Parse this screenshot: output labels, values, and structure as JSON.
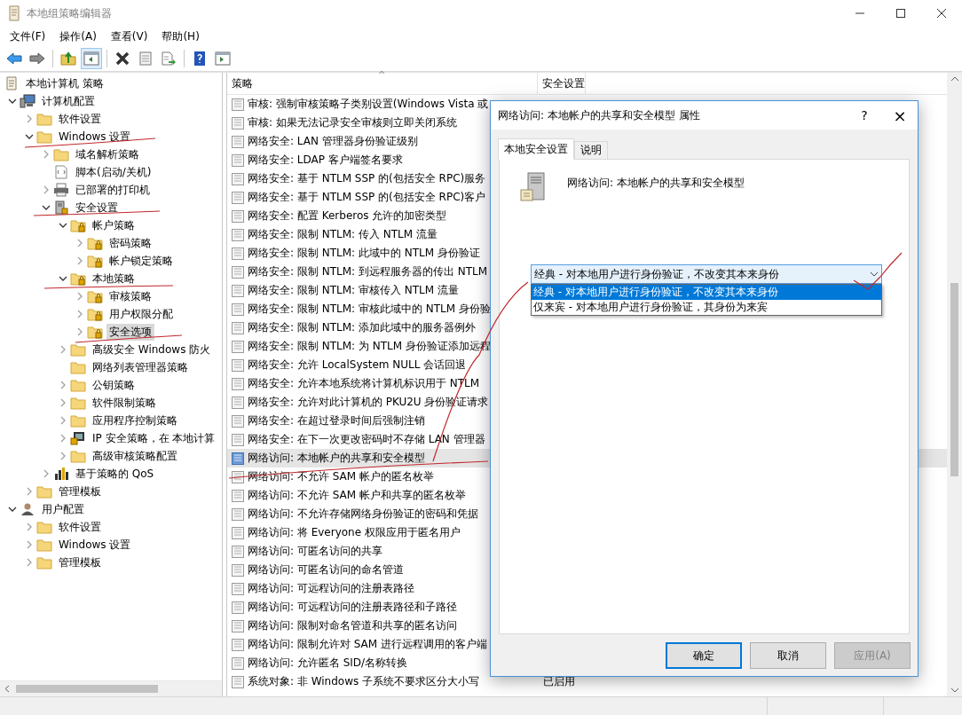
{
  "window": {
    "title": "本地组策略编辑器"
  },
  "menu": [
    "文件(F)",
    "操作(A)",
    "查看(V)",
    "帮助(H)"
  ],
  "toolbar": [
    {
      "kind": "back",
      "pressed": false
    },
    {
      "kind": "forward",
      "pressed": false
    },
    {
      "kind": "sep"
    },
    {
      "kind": "up",
      "pressed": false
    },
    {
      "kind": "tree",
      "pressed": true
    },
    {
      "kind": "sep"
    },
    {
      "kind": "delete",
      "pressed": false
    },
    {
      "kind": "properties",
      "pressed": false
    },
    {
      "kind": "export",
      "pressed": false
    },
    {
      "kind": "sep"
    },
    {
      "kind": "help",
      "pressed": false
    },
    {
      "kind": "pane",
      "pressed": false
    }
  ],
  "tree": [
    {
      "label": "本地计算机 策略",
      "kind": "root",
      "selected": false,
      "children": [
        {
          "label": "计算机配置",
          "kind": "computer",
          "expanded": true,
          "selected": false,
          "children": [
            {
              "label": "软件设置",
              "kind": "folder",
              "expanded": false,
              "selected": false
            },
            {
              "label": "Windows 设置",
              "kind": "folder",
              "expanded": true,
              "selected": false,
              "children": [
                {
                  "label": "域名解析策略",
                  "kind": "folder",
                  "expanded": false,
                  "selected": false
                },
                {
                  "label": "脚本(启动/关机)",
                  "kind": "script",
                  "selected": false
                },
                {
                  "label": "已部署的打印机",
                  "kind": "printer",
                  "expanded": false,
                  "selected": false
                },
                {
                  "label": "安全设置",
                  "kind": "server",
                  "expanded": true,
                  "selected": false,
                  "children": [
                    {
                      "label": "帐户策略",
                      "kind": "secure-folder",
                      "expanded": true,
                      "selected": false,
                      "children": [
                        {
                          "label": "密码策略",
                          "kind": "secure-folder",
                          "expanded": false,
                          "selected": false
                        },
                        {
                          "label": "帐户锁定策略",
                          "kind": "secure-folder",
                          "expanded": false,
                          "selected": false
                        }
                      ]
                    },
                    {
                      "label": "本地策略",
                      "kind": "secure-folder",
                      "expanded": true,
                      "selected": false,
                      "children": [
                        {
                          "label": "审核策略",
                          "kind": "secure-folder",
                          "expanded": false,
                          "selected": false
                        },
                        {
                          "label": "用户权限分配",
                          "kind": "secure-folder",
                          "expanded": false,
                          "selected": false
                        },
                        {
                          "label": "安全选项",
                          "kind": "secure-folder",
                          "expanded": false,
                          "selected": true
                        }
                      ]
                    },
                    {
                      "label": "高级安全 Windows 防火",
                      "kind": "folder",
                      "expanded": false,
                      "selected": false
                    },
                    {
                      "label": "网络列表管理器策略",
                      "kind": "folder",
                      "selected": false
                    },
                    {
                      "label": "公钥策略",
                      "kind": "folder",
                      "expanded": false,
                      "selected": false
                    },
                    {
                      "label": "软件限制策略",
                      "kind": "folder",
                      "expanded": false,
                      "selected": false
                    },
                    {
                      "label": "应用程序控制策略",
                      "kind": "folder",
                      "expanded": false,
                      "selected": false
                    },
                    {
                      "label": "IP 安全策略，在 本地计算",
                      "kind": "monitor",
                      "expanded": false,
                      "selected": false
                    },
                    {
                      "label": "高级审核策略配置",
                      "kind": "folder",
                      "expanded": false,
                      "selected": false
                    }
                  ]
                },
                {
                  "label": "基于策略的 QoS",
                  "kind": "chart",
                  "expanded": false,
                  "selected": false
                }
              ]
            },
            {
              "label": "管理模板",
              "kind": "folder",
              "expanded": false,
              "selected": false
            }
          ]
        },
        {
          "label": "用户配置",
          "kind": "user",
          "expanded": true,
          "selected": false,
          "children": [
            {
              "label": "软件设置",
              "kind": "folder",
              "expanded": false,
              "selected": false
            },
            {
              "label": "Windows 设置",
              "kind": "folder",
              "expanded": false,
              "selected": false
            },
            {
              "label": "管理模板",
              "kind": "folder",
              "expanded": false,
              "selected": false
            }
          ]
        }
      ]
    }
  ],
  "table": {
    "sort_indicator": "^",
    "columns": [
      "策略",
      "安全设置"
    ],
    "rows": [
      {
        "policy": "审核: 强制审核策略子类别设置(Windows Vista 或",
        "selected": false
      },
      {
        "policy": "审核: 如果无法记录安全审核则立即关闭系统",
        "selected": false
      },
      {
        "policy": "网络安全: LAN 管理器身份验证级别",
        "selected": false
      },
      {
        "policy": "网络安全: LDAP 客户端签名要求",
        "selected": false
      },
      {
        "policy": "网络安全: 基于 NTLM SSP 的(包括安全 RPC)服务",
        "selected": false
      },
      {
        "policy": "网络安全: 基于 NTLM SSP 的(包括安全 RPC)客户",
        "selected": false
      },
      {
        "policy": "网络安全: 配置 Kerberos 允许的加密类型",
        "selected": false
      },
      {
        "policy": "网络安全: 限制 NTLM: 传入 NTLM 流量",
        "selected": false
      },
      {
        "policy": "网络安全: 限制 NTLM: 此域中的 NTLM 身份验证",
        "selected": false
      },
      {
        "policy": "网络安全: 限制 NTLM: 到远程服务器的传出 NTLM",
        "selected": false
      },
      {
        "policy": "网络安全: 限制 NTLM: 审核传入 NTLM 流量",
        "selected": false
      },
      {
        "policy": "网络安全: 限制 NTLM: 审核此域中的 NTLM 身份验",
        "selected": false
      },
      {
        "policy": "网络安全: 限制 NTLM: 添加此域中的服务器例外",
        "selected": false
      },
      {
        "policy": "网络安全: 限制 NTLM: 为 NTLM 身份验证添加远程",
        "selected": false
      },
      {
        "policy": "网络安全: 允许 LocalSystem NULL 会话回退",
        "selected": false
      },
      {
        "policy": "网络安全: 允许本地系统将计算机标识用于 NTLM",
        "selected": false
      },
      {
        "policy": "网络安全: 允许对此计算机的 PKU2U 身份验证请求",
        "selected": false
      },
      {
        "policy": "网络安全: 在超过登录时间后强制注销",
        "selected": false
      },
      {
        "policy": "网络安全: 在下一次更改密码时不存储 LAN 管理器",
        "selected": false
      },
      {
        "policy": "网络访问: 本地帐户的共享和安全模型",
        "selected": true
      },
      {
        "policy": "网络访问: 不允许 SAM 帐户的匿名枚举",
        "selected": false
      },
      {
        "policy": "网络访问: 不允许 SAM 帐户和共享的匿名枚举",
        "selected": false
      },
      {
        "policy": "网络访问: 不允许存储网络身份验证的密码和凭据",
        "selected": false
      },
      {
        "policy": "网络访问: 将 Everyone 权限应用于匿名用户",
        "selected": false
      },
      {
        "policy": "网络访问: 可匿名访问的共享",
        "selected": false
      },
      {
        "policy": "网络访问: 可匿名访问的命名管道",
        "selected": false
      },
      {
        "policy": "网络访问: 可远程访问的注册表路径",
        "selected": false
      },
      {
        "policy": "网络访问: 可远程访问的注册表路径和子路径",
        "selected": false
      },
      {
        "policy": "网络访问: 限制对命名管道和共享的匿名访问",
        "selected": false
      },
      {
        "policy": "网络访问: 限制允许对 SAM 进行远程调用的客户端",
        "selected": false
      },
      {
        "policy": "网络访问: 允许匿名 SID/名称转换",
        "selected": false
      },
      {
        "policy": "系统对象: 非 Windows 子系统不要求区分大小写",
        "setting": "已启用",
        "selected": false
      }
    ]
  },
  "dialog": {
    "title": "网络访问: 本地帐户的共享和安全模型 属性",
    "help": "?",
    "close": "×",
    "tabs": [
      {
        "label": "本地安全设置",
        "selected": true
      },
      {
        "label": "说明",
        "selected": false
      }
    ],
    "heading": "网络访问: 本地帐户的共享和安全模型",
    "combobox": {
      "value": "经典 - 对本地用户进行身份验证，不改变其本来身份",
      "expanded": true,
      "options": [
        {
          "label": "经典 - 对本地用户进行身份验证，不改变其本来身份",
          "selected": true
        },
        {
          "label": "仅来宾 - 对本地用户进行身份验证，其身份为来宾",
          "selected": false
        }
      ]
    },
    "buttons": [
      {
        "label": "确定",
        "default": true,
        "disabled": false
      },
      {
        "label": "取消",
        "default": false,
        "disabled": false
      },
      {
        "label": "应用(A)",
        "default": false,
        "disabled": true
      }
    ]
  }
}
